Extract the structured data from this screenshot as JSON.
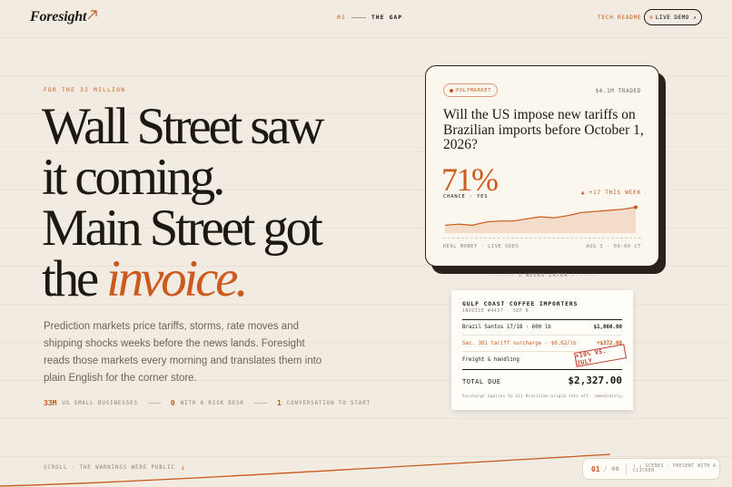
{
  "header": {
    "logo": "Foresight",
    "nav_number": "01",
    "nav_label": "THE GAP",
    "tech_readme": "TECH README",
    "live_demo": "LIVE DEMO ↗"
  },
  "hero": {
    "eyebrow": "FOR THE 33 MILLION",
    "headline_line1": "Wall Street saw",
    "headline_line2": "it coming.",
    "headline_line3": "Main Street got",
    "headline_line4_prefix": "the ",
    "headline_line4_em": "invoice.",
    "lede": "Prediction markets price tariffs, storms, rate moves and shipping shocks weeks before the news lands. Foresight reads those markets every morning and translates them into plain English for the corner store.",
    "stats": [
      {
        "value": "33M",
        "label": "US SMALL BUSINESSES"
      },
      {
        "value": "0",
        "label": "WITH A RISK DESK"
      },
      {
        "value": "1",
        "label": "CONVERSATION TO START"
      }
    ],
    "scroll_hint": "SCROLL · THE WARNINGS WERE PUBLIC",
    "scroll_arrow": "↓"
  },
  "market_card": {
    "source": "POLYMARKET",
    "traded": "$4.1M TRADED",
    "question": "Will the US impose new tariffs on Brazilian imports before October 1, 2026?",
    "chance": "71%",
    "chance_label": "CHANCE · YES",
    "delta": "▲ +17 THIS WEEK",
    "footer_left": "REAL MONEY · LIVE ODDS",
    "footer_right": "AUG 3 · 09:00 CT",
    "sparkline": [
      54,
      55,
      54,
      57,
      58,
      58,
      60,
      62,
      61,
      63,
      66,
      67,
      68,
      69,
      71
    ]
  },
  "timeline_label": "------- 5 WEEKS LATER -------",
  "invoice": {
    "company": "GULF COAST COFFEE IMPORTERS",
    "meta": "INVOICE #4417 · SEP 8",
    "lines": [
      {
        "desc": "Brazil Santos 17/18 · 600 lb",
        "amount": "$1,860.00",
        "highlight": false
      },
      {
        "desc": "Sec. 301 tariff surcharge · $0.62/lb",
        "amount": "+$372.00",
        "highlight": true
      },
      {
        "desc": "Freight & handling",
        "amount": "",
        "highlight": false
      }
    ],
    "stamp": "+19% VS. JULY",
    "total_label": "TOTAL DUE",
    "total": "$2,327.00",
    "note": "Surcharge applies to all Brazilian-origin lots eff. immediately."
  },
  "pager": {
    "current": "01",
    "separator": "/",
    "total": "08",
    "hint": "↑ ↓ SCENES · PRESENT WITH A CLICKER"
  },
  "colors": {
    "accent": "#c8581a",
    "background": "#f1ebe1",
    "ink": "#1c1814",
    "stamp": "#c0392b"
  }
}
